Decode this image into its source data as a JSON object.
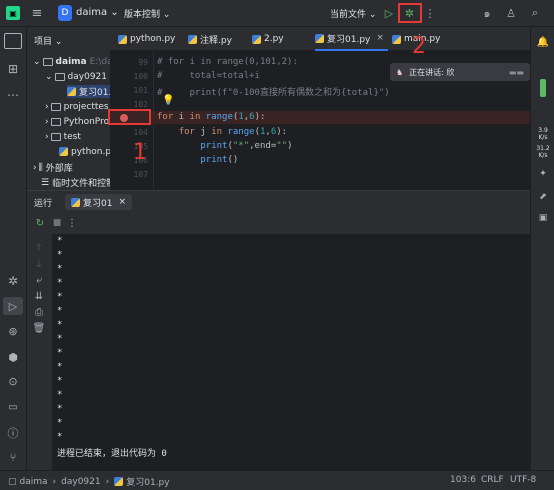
{
  "titlebar": {
    "project_badge": "D",
    "project_name": "daima",
    "vcs_label": "版本控制",
    "run_config": "当前文件"
  },
  "project_panel": {
    "title": "项目",
    "items": [
      {
        "label": "daima",
        "suffix": "E:\\da",
        "kind": "folder"
      },
      {
        "label": "day0921",
        "kind": "folder"
      },
      {
        "label": "复习01.",
        "kind": "file"
      },
      {
        "label": "projecttes",
        "kind": "folder"
      },
      {
        "label": "PythonPro",
        "kind": "folder"
      },
      {
        "label": "test",
        "kind": "folder"
      },
      {
        "label": "python.py",
        "kind": "file"
      },
      {
        "label": "外部库",
        "kind": "lib"
      },
      {
        "label": "临时文件和控制",
        "kind": "scratch"
      }
    ]
  },
  "tabs": [
    {
      "label": "python.py"
    },
    {
      "label": "注释.py"
    },
    {
      "label": "2.py"
    },
    {
      "label": "复习01.py",
      "close": "×",
      "active": true
    },
    {
      "label": "main.py"
    }
  ],
  "editor": {
    "lines": [
      {
        "num": "99",
        "text": "# for i in range(0,101,2):"
      },
      {
        "num": "100",
        "text": "#     total=total+i"
      },
      {
        "num": "101",
        "text": "#     print(f\"0-100直接所有偶数之和为{total}\")"
      },
      {
        "num": "102",
        "text": ""
      },
      {
        "num": "",
        "text": "for i in range(1,6):"
      },
      {
        "num": "104",
        "text": "    for j in range(1,6):"
      },
      {
        "num": "105",
        "text": "        print(\"*\",end=\"\")"
      },
      {
        "num": "106",
        "text": "        print()"
      },
      {
        "num": "107",
        "text": ""
      }
    ],
    "hint_popup": "正在讲话: 欣"
  },
  "run_panel": {
    "tab_label": "运行",
    "config": "复习01",
    "output": [
      "*",
      "*",
      "*",
      "*",
      "*",
      "*",
      "*",
      "*",
      "*",
      "*",
      "*",
      "*",
      "*",
      "*",
      "*"
    ],
    "exit_message": "进程已结束，退出代码为 0"
  },
  "status_bar": {
    "breadcrumb": [
      "daima",
      "day0921",
      "复习01.py"
    ],
    "position": "103:6",
    "line_sep": "CRLF",
    "encoding": "UTF-8"
  },
  "right_strip": {
    "net_up": "3.9",
    "net_up_unit": "K/s",
    "net_down": "31.2",
    "net_down_unit": "K/s"
  },
  "annotations": {
    "one": "1",
    "two": "2"
  },
  "colors": {
    "accent": "#3574f0",
    "annotation": "#e53935",
    "breakpoint": "#db5c5c",
    "run_green": "#5fb865"
  }
}
